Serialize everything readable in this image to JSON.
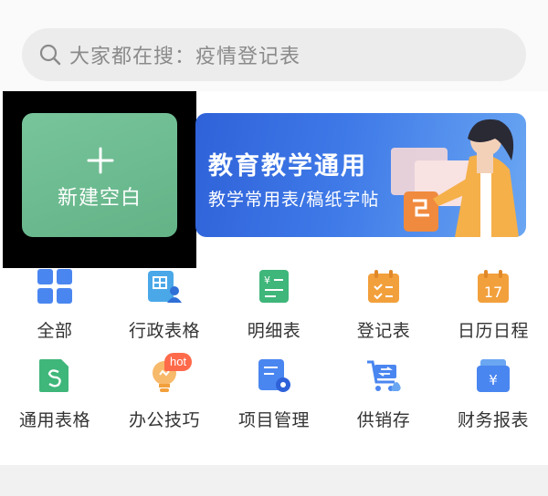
{
  "search": {
    "text": "大家都在搜：疫情登记表"
  },
  "new_blank": {
    "label": "新建空白"
  },
  "banner": {
    "title": "教育教学通用",
    "subtitle": "教学常用表/稿纸字帖"
  },
  "categories": [
    {
      "label": "全部",
      "icon": "grid-icon",
      "color": "#4a86f0"
    },
    {
      "label": "行政表格",
      "icon": "admin-table-icon",
      "color": "#4aa8e8"
    },
    {
      "label": "明细表",
      "icon": "detail-list-icon",
      "color": "#3fb67a"
    },
    {
      "label": "登记表",
      "icon": "register-calendar-icon",
      "color": "#f2a03c"
    },
    {
      "label": "日历日程",
      "icon": "calendar-17-icon",
      "color": "#f2a03c"
    },
    {
      "label": "通用表格",
      "icon": "spreadsheet-icon",
      "color": "#3fb67a"
    },
    {
      "label": "办公技巧",
      "icon": "lightbulb-icon",
      "color": "#f2a03c",
      "badge": "hot"
    },
    {
      "label": "项目管理",
      "icon": "project-settings-icon",
      "color": "#4a86f0"
    },
    {
      "label": "供销存",
      "icon": "cart-icon",
      "color": "#4a86f0"
    },
    {
      "label": "财务报表",
      "icon": "finance-report-icon",
      "color": "#4a86f0"
    }
  ]
}
